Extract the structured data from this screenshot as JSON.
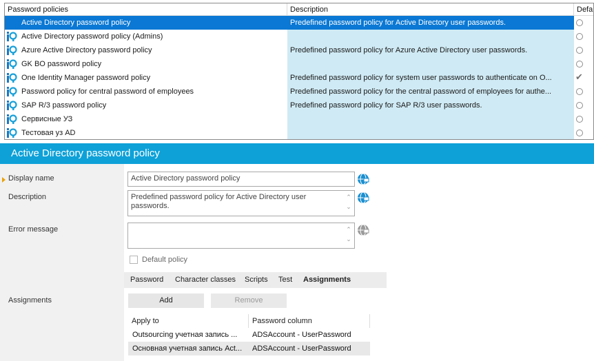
{
  "grid": {
    "headers": {
      "name": "Password policies",
      "description": "Description",
      "default": "Defau"
    },
    "rows": [
      {
        "name": "Active Directory password policy",
        "description": "Predefined password policy for Active Directory user passwords.",
        "default": false,
        "selected": true
      },
      {
        "name": "Active Directory password policy (Admins)",
        "description": "",
        "default": false
      },
      {
        "name": "Azure Active Directory password policy",
        "description": "Predefined password policy for Azure Active Directory user passwords.",
        "default": false
      },
      {
        "name": "GK BO password policy",
        "description": "",
        "default": false
      },
      {
        "name": "One Identity Manager password policy",
        "description": "Predefined password policy for system user passwords to authenticate on O...",
        "default": true
      },
      {
        "name": "Password policy for central password of employees",
        "description": "Predefined password policy for the central password of employees for authe...",
        "default": false
      },
      {
        "name": "SAP R/3 password policy",
        "description": "Predefined password policy for SAP R/3 user passwords.",
        "default": false
      },
      {
        "name": "Сервисные УЗ",
        "description": "",
        "default": false
      },
      {
        "name": "Тестовая уз AD",
        "description": "",
        "default": false
      }
    ]
  },
  "detail": {
    "title": "Active Directory password policy",
    "display_name_label": "Display name",
    "display_name_value": "Active Directory password policy",
    "description_label": "Description",
    "description_value": "Predefined password policy for Active Directory user passwords.",
    "error_message_label": "Error message",
    "error_message_value": "",
    "default_policy_label": "Default policy",
    "tabs": [
      "Password",
      "Character classes",
      "Scripts",
      "Test",
      "Assignments"
    ],
    "active_tab": "Assignments",
    "assignments_label": "Assignments",
    "add_label": "Add",
    "remove_label": "Remove",
    "columns": {
      "apply_to": "Apply to",
      "password_column": "Password column"
    },
    "assignments": [
      {
        "apply_to": "Outsourcing учетная запись ...",
        "password_column": "ADSAccount - UserPassword"
      },
      {
        "apply_to": "Основная учетная запись Act...",
        "password_column": "ADSAccount - UserPassword"
      }
    ]
  },
  "colors": {
    "selection": "#0a78d4",
    "banner": "#0ea1d8",
    "description_column": "#cfeaf4",
    "marker": "#e8a20c"
  }
}
